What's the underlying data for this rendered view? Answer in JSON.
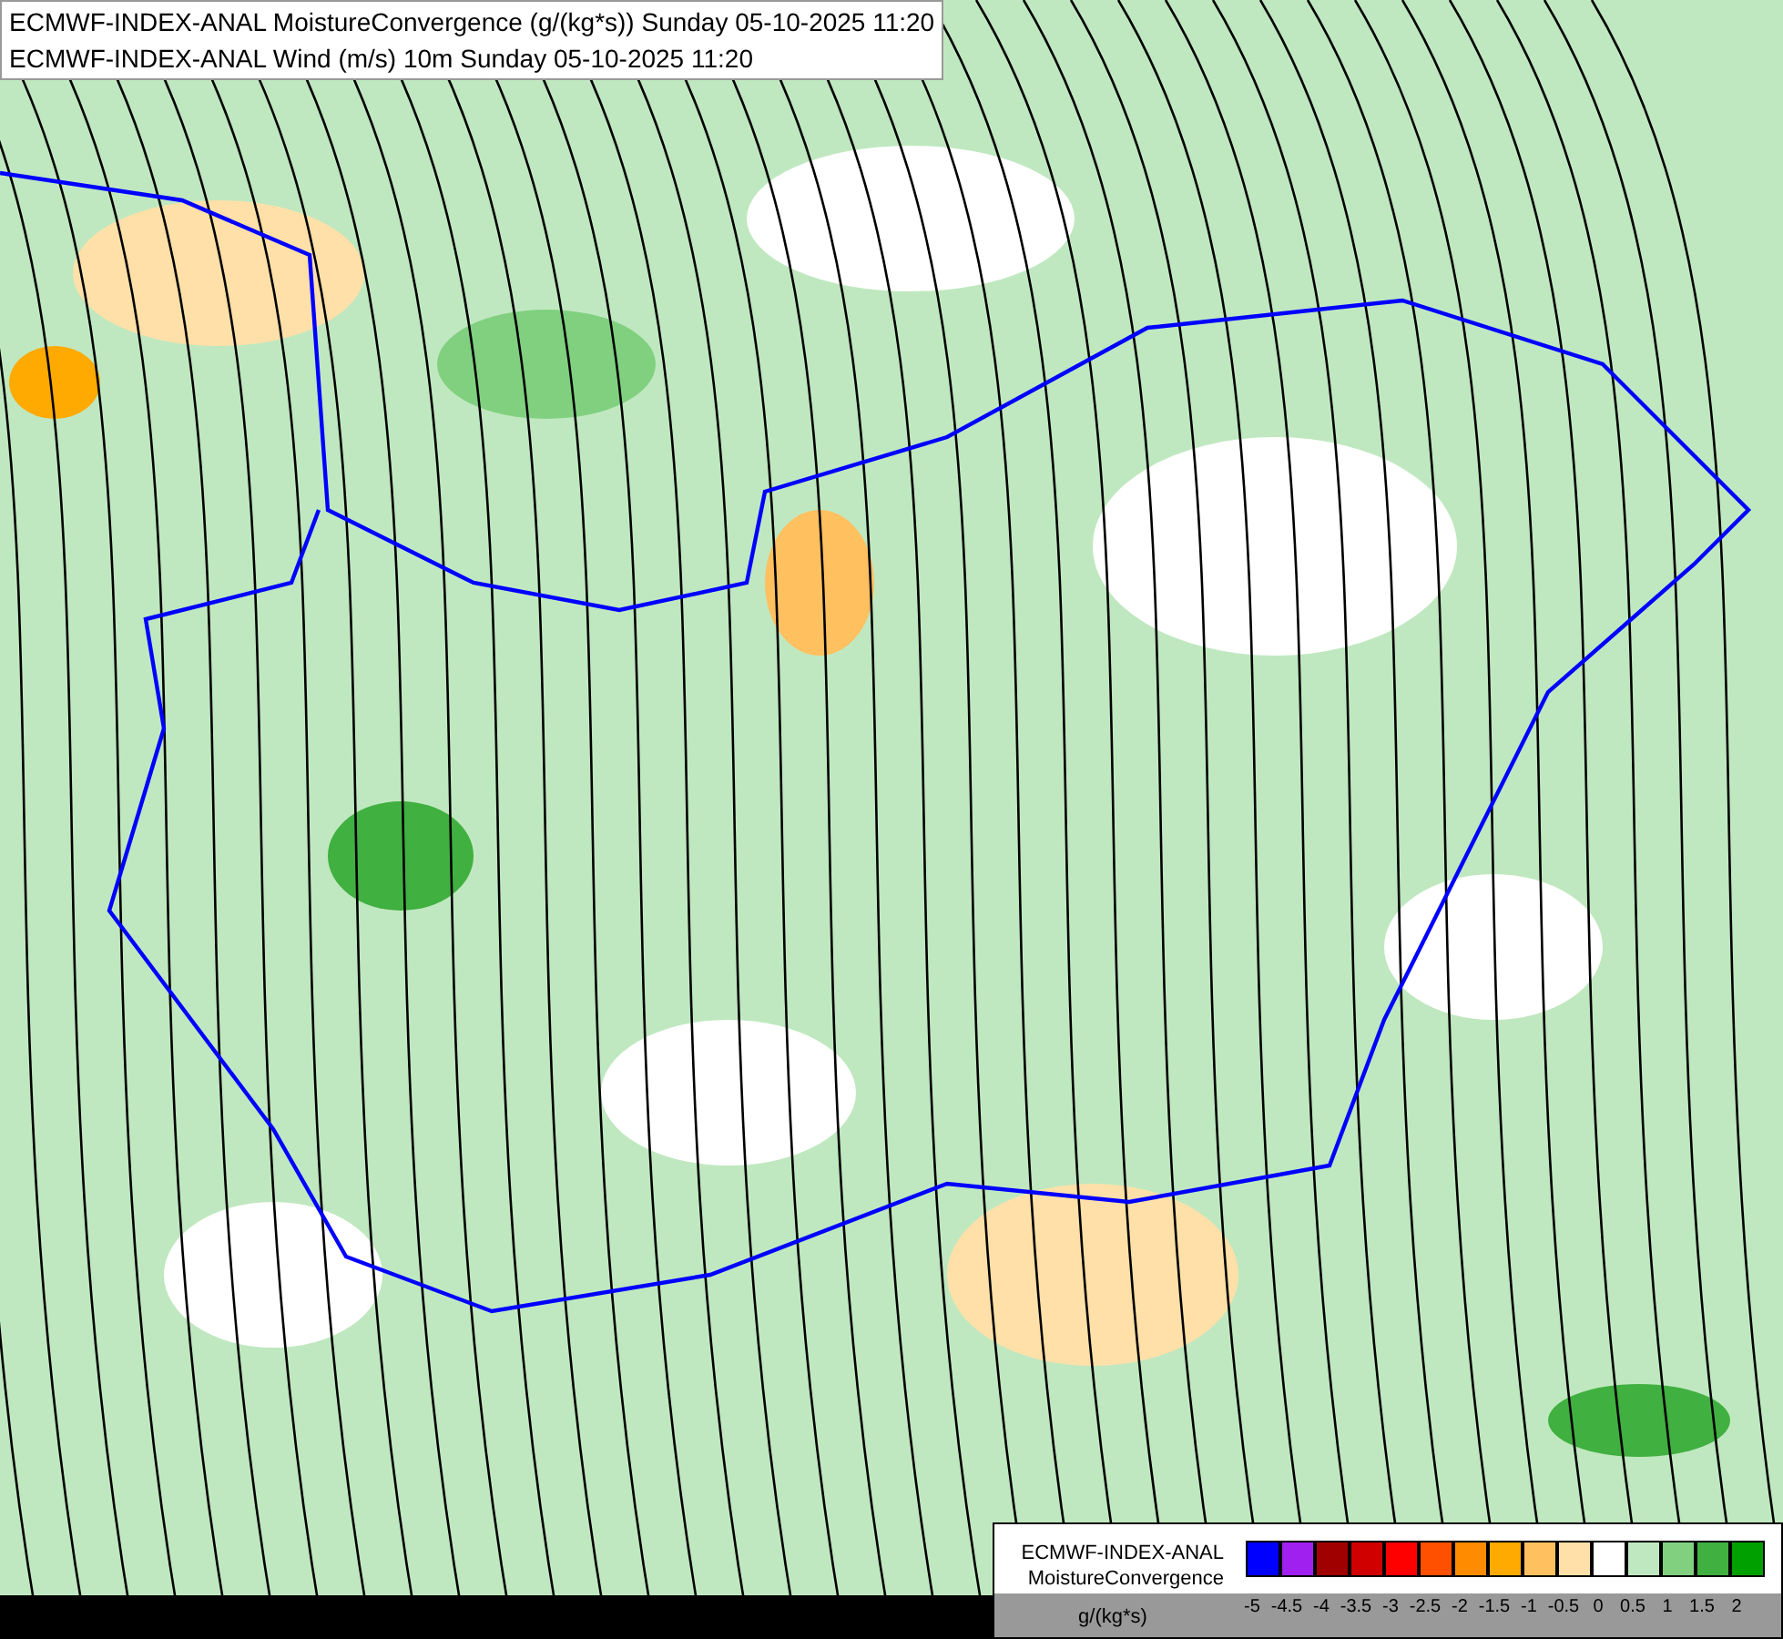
{
  "header": {
    "lines": [
      "ECMWF-INDEX-ANAL MoistureConvergence (g/(kg*s)) Sunday 05-10-2025 11:20",
      "ECMWF-INDEX-ANAL Wind (m/s) 10m Sunday 05-10-2025 11:20"
    ]
  },
  "legend": {
    "title_lines": [
      "ECMWF-INDEX-ANAL",
      "MoistureConvergence"
    ],
    "unit": "g/(kg*s)",
    "bins": [
      {
        "color": "#0000ff"
      },
      {
        "color": "#a020f0"
      },
      {
        "color": "#a00000"
      },
      {
        "color": "#d00000"
      },
      {
        "color": "#ff0000"
      },
      {
        "color": "#ff5000"
      },
      {
        "color": "#ff8c00"
      },
      {
        "color": "#ffaa00"
      },
      {
        "color": "#ffc060"
      },
      {
        "color": "#ffe0a8"
      },
      {
        "color": "#ffffff"
      },
      {
        "color": "#c0e8c0"
      },
      {
        "color": "#80d080"
      },
      {
        "color": "#40b040"
      },
      {
        "color": "#00a000"
      }
    ],
    "ticks": [
      "-5",
      "-4.5",
      "-4",
      "-3.5",
      "-3",
      "-2.5",
      "-2",
      "-1.5",
      "-1",
      "-0.5",
      "0",
      "0.5",
      "1",
      "1.5",
      "2"
    ]
  }
}
